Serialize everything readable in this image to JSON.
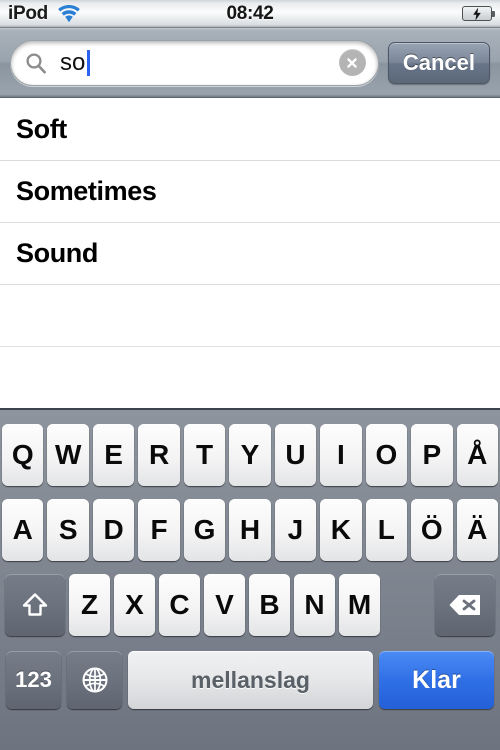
{
  "statusbar": {
    "carrier": "iPod",
    "wifi_icon": "wifi-icon",
    "time": "08:42",
    "battery_icon": "battery-charging-icon"
  },
  "search": {
    "icon": "search-icon",
    "value": "so",
    "placeholder": "Search",
    "clear_icon": "clear-circle-icon",
    "cancel_label": "Cancel"
  },
  "results": {
    "rows": [
      {
        "label": "Soft"
      },
      {
        "label": "Sometimes"
      },
      {
        "label": "Sound"
      },
      {
        "label": ""
      },
      {
        "label": ""
      }
    ]
  },
  "keyboard": {
    "layout": "swedish-qwerty",
    "row1": [
      "Q",
      "W",
      "E",
      "R",
      "T",
      "Y",
      "U",
      "I",
      "O",
      "P",
      "Å"
    ],
    "row2": [
      "A",
      "S",
      "D",
      "F",
      "G",
      "H",
      "J",
      "K",
      "L",
      "Ö",
      "Ä"
    ],
    "row3": {
      "shift_icon": "shift-arrow-icon",
      "letters": [
        "Z",
        "X",
        "C",
        "V",
        "B",
        "N",
        "M"
      ],
      "backspace_icon": "backspace-icon"
    },
    "row4": {
      "numbers_label": "123",
      "globe_icon": "globe-icon",
      "space_label": "mellanslag",
      "done_label": "Klar"
    }
  },
  "colors": {
    "keyboard_bg": "#7b828e",
    "key_light": "#f4f4f5",
    "key_dark": "#6b727d",
    "done_blue": "#2f6fe6",
    "caret_blue": "#2b62f0",
    "battery_green": "#62cc13",
    "wifi_blue": "#2a7fd4"
  }
}
